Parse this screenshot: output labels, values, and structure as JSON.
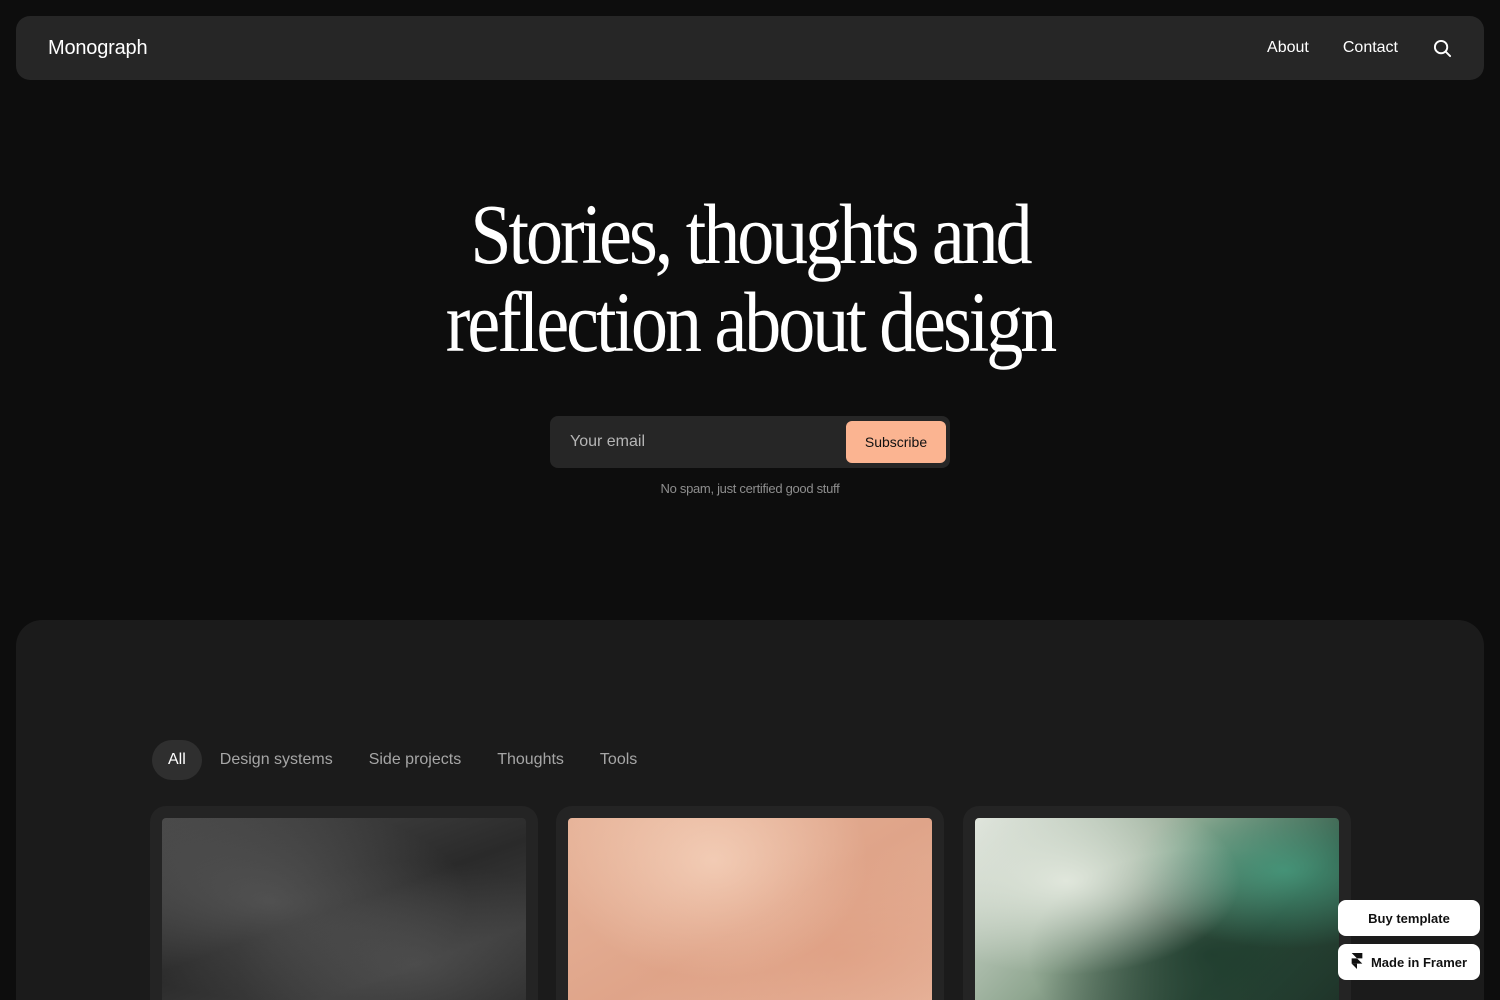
{
  "header": {
    "brand": "Monograph",
    "nav": [
      {
        "label": "About"
      },
      {
        "label": "Contact"
      }
    ],
    "search_icon": "search-icon"
  },
  "hero": {
    "title_line1": "Stories, thoughts and",
    "title_line2": "reflection about design",
    "email_placeholder": "Your email",
    "email_value": "",
    "subscribe_label": "Subscribe",
    "note": "No spam, just certified good stuff"
  },
  "filters": [
    {
      "label": "All",
      "active": true
    },
    {
      "label": "Design systems",
      "active": false
    },
    {
      "label": "Side projects",
      "active": false
    },
    {
      "label": "Thoughts",
      "active": false
    },
    {
      "label": "Tools",
      "active": false
    }
  ],
  "cards": [
    {
      "image": "dark-texture"
    },
    {
      "image": "peach-marble"
    },
    {
      "image": "green-leaves"
    }
  ],
  "floating": {
    "buy_label": "Buy template",
    "framer_label": "Made in Framer",
    "framer_icon": "framer-logo-icon"
  },
  "colors": {
    "background": "#0d0d0d",
    "nav_bg": "#262626",
    "panel_bg": "#1b1b1b",
    "accent": "#fbb491"
  }
}
